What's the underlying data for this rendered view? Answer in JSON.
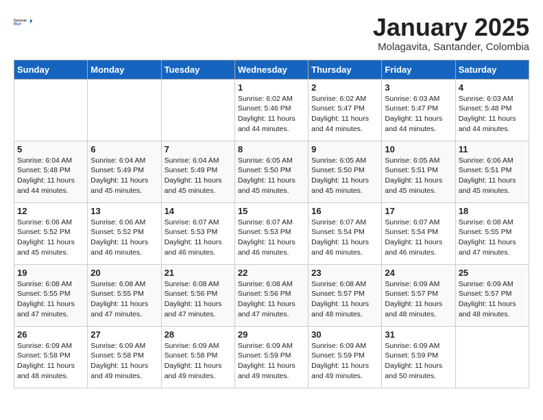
{
  "header": {
    "logo_general": "General",
    "logo_blue": "Blue",
    "month": "January 2025",
    "location": "Molagavita, Santander, Colombia"
  },
  "weekdays": [
    "Sunday",
    "Monday",
    "Tuesday",
    "Wednesday",
    "Thursday",
    "Friday",
    "Saturday"
  ],
  "weeks": [
    [
      {
        "day": "",
        "info": ""
      },
      {
        "day": "",
        "info": ""
      },
      {
        "day": "",
        "info": ""
      },
      {
        "day": "1",
        "info": "Sunrise: 6:02 AM\nSunset: 5:46 PM\nDaylight: 11 hours\nand 44 minutes."
      },
      {
        "day": "2",
        "info": "Sunrise: 6:02 AM\nSunset: 5:47 PM\nDaylight: 11 hours\nand 44 minutes."
      },
      {
        "day": "3",
        "info": "Sunrise: 6:03 AM\nSunset: 5:47 PM\nDaylight: 11 hours\nand 44 minutes."
      },
      {
        "day": "4",
        "info": "Sunrise: 6:03 AM\nSunset: 5:48 PM\nDaylight: 11 hours\nand 44 minutes."
      }
    ],
    [
      {
        "day": "5",
        "info": "Sunrise: 6:04 AM\nSunset: 5:48 PM\nDaylight: 11 hours\nand 44 minutes."
      },
      {
        "day": "6",
        "info": "Sunrise: 6:04 AM\nSunset: 5:49 PM\nDaylight: 11 hours\nand 45 minutes."
      },
      {
        "day": "7",
        "info": "Sunrise: 6:04 AM\nSunset: 5:49 PM\nDaylight: 11 hours\nand 45 minutes."
      },
      {
        "day": "8",
        "info": "Sunrise: 6:05 AM\nSunset: 5:50 PM\nDaylight: 11 hours\nand 45 minutes."
      },
      {
        "day": "9",
        "info": "Sunrise: 6:05 AM\nSunset: 5:50 PM\nDaylight: 11 hours\nand 45 minutes."
      },
      {
        "day": "10",
        "info": "Sunrise: 6:05 AM\nSunset: 5:51 PM\nDaylight: 11 hours\nand 45 minutes."
      },
      {
        "day": "11",
        "info": "Sunrise: 6:06 AM\nSunset: 5:51 PM\nDaylight: 11 hours\nand 45 minutes."
      }
    ],
    [
      {
        "day": "12",
        "info": "Sunrise: 6:06 AM\nSunset: 5:52 PM\nDaylight: 11 hours\nand 45 minutes."
      },
      {
        "day": "13",
        "info": "Sunrise: 6:06 AM\nSunset: 5:52 PM\nDaylight: 11 hours\nand 46 minutes."
      },
      {
        "day": "14",
        "info": "Sunrise: 6:07 AM\nSunset: 5:53 PM\nDaylight: 11 hours\nand 46 minutes."
      },
      {
        "day": "15",
        "info": "Sunrise: 6:07 AM\nSunset: 5:53 PM\nDaylight: 11 hours\nand 46 minutes."
      },
      {
        "day": "16",
        "info": "Sunrise: 6:07 AM\nSunset: 5:54 PM\nDaylight: 11 hours\nand 46 minutes."
      },
      {
        "day": "17",
        "info": "Sunrise: 6:07 AM\nSunset: 5:54 PM\nDaylight: 11 hours\nand 46 minutes."
      },
      {
        "day": "18",
        "info": "Sunrise: 6:08 AM\nSunset: 5:55 PM\nDaylight: 11 hours\nand 47 minutes."
      }
    ],
    [
      {
        "day": "19",
        "info": "Sunrise: 6:08 AM\nSunset: 5:55 PM\nDaylight: 11 hours\nand 47 minutes."
      },
      {
        "day": "20",
        "info": "Sunrise: 6:08 AM\nSunset: 5:55 PM\nDaylight: 11 hours\nand 47 minutes."
      },
      {
        "day": "21",
        "info": "Sunrise: 6:08 AM\nSunset: 5:56 PM\nDaylight: 11 hours\nand 47 minutes."
      },
      {
        "day": "22",
        "info": "Sunrise: 6:08 AM\nSunset: 5:56 PM\nDaylight: 11 hours\nand 47 minutes."
      },
      {
        "day": "23",
        "info": "Sunrise: 6:08 AM\nSunset: 5:57 PM\nDaylight: 11 hours\nand 48 minutes."
      },
      {
        "day": "24",
        "info": "Sunrise: 6:09 AM\nSunset: 5:57 PM\nDaylight: 11 hours\nand 48 minutes."
      },
      {
        "day": "25",
        "info": "Sunrise: 6:09 AM\nSunset: 5:57 PM\nDaylight: 11 hours\nand 48 minutes."
      }
    ],
    [
      {
        "day": "26",
        "info": "Sunrise: 6:09 AM\nSunset: 5:58 PM\nDaylight: 11 hours\nand 48 minutes."
      },
      {
        "day": "27",
        "info": "Sunrise: 6:09 AM\nSunset: 5:58 PM\nDaylight: 11 hours\nand 49 minutes."
      },
      {
        "day": "28",
        "info": "Sunrise: 6:09 AM\nSunset: 5:58 PM\nDaylight: 11 hours\nand 49 minutes."
      },
      {
        "day": "29",
        "info": "Sunrise: 6:09 AM\nSunset: 5:59 PM\nDaylight: 11 hours\nand 49 minutes."
      },
      {
        "day": "30",
        "info": "Sunrise: 6:09 AM\nSunset: 5:59 PM\nDaylight: 11 hours\nand 49 minutes."
      },
      {
        "day": "31",
        "info": "Sunrise: 6:09 AM\nSunset: 5:59 PM\nDaylight: 11 hours\nand 50 minutes."
      },
      {
        "day": "",
        "info": ""
      }
    ]
  ]
}
